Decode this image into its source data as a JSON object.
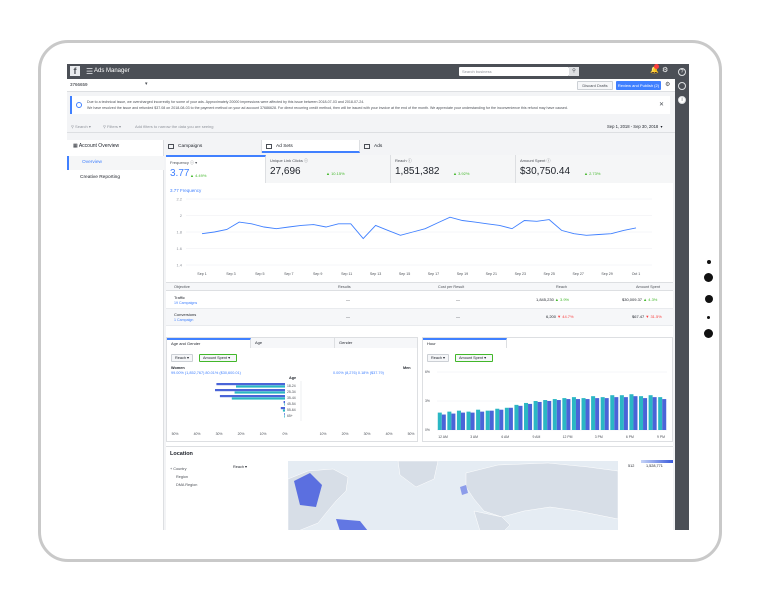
{
  "topbar": {
    "logo": "f",
    "menu_icon": "hamburger-icon",
    "title": "Ads Manager",
    "search_placeholder": "Search business"
  },
  "account_bar": {
    "account": "3766659",
    "discard": "Discard Drafts",
    "review": "Review and Publish (2)"
  },
  "notice": {
    "line1": "Due to a technical issue, we overcharged incorrectly for some of your ads. Approximately 20000 impressions were affected by this issue between 2018-07-03 and 2018-07-24.",
    "line2": "We have resolved the issue and refunded $37.08 on 2018-08-03 to the payment method on your ad account 37686628. For direct recurring credit method, then will be issued with your invoice at the end of the month. We appreciate your understanding for the inconvenience this refund may have caused."
  },
  "filters": {
    "search": "Search",
    "filters": "Filters",
    "hint": "Add filters to narrow the data you are seeing",
    "date_range": "Sep 1, 2018 - Sep 30, 2018"
  },
  "leftnav": {
    "heading": "Account Overview",
    "items": [
      "Overview",
      "Creative Reporting"
    ]
  },
  "tabs": [
    "Campaigns",
    "Ad Sets",
    "Ads"
  ],
  "metrics": [
    {
      "label": "Frequency",
      "value": "3.77",
      "delta": "4.49%"
    },
    {
      "label": "Unique Link Clicks",
      "value": "27,696",
      "delta": "10.15%"
    },
    {
      "label": "Reach",
      "value": "1,851,382",
      "delta": "3.92%"
    },
    {
      "label": "Amount Spent",
      "value": "$30,750.44",
      "delta": "2.73%"
    }
  ],
  "chart_data": {
    "type": "line",
    "title": "3.77 Frequency",
    "categories": [
      "Sep 1",
      "Sep 3",
      "Sep 5",
      "Sep 7",
      "Sep 9",
      "Sep 11",
      "Sep 13",
      "Sep 15",
      "Sep 17",
      "Sep 19",
      "Sep 21",
      "Sep 23",
      "Sep 25",
      "Sep 27",
      "Sep 29",
      "Oct 1"
    ],
    "x_labels": [
      "Sep 1",
      "Sep 3",
      "Sep 5",
      "Sep 7",
      "Sep 9",
      "Sep 11",
      "Sep 13",
      "Sep 15",
      "Sep 17",
      "Sep 19",
      "Sep 21",
      "Sep 23",
      "Sep 25",
      "Sep 27",
      "Sep 29",
      "Oct 1"
    ],
    "y_ticks": [
      "2.2",
      "2",
      "1.8",
      "1.6",
      "1.4"
    ],
    "ylim": [
      1.4,
      2.2
    ],
    "values": [
      1.78,
      1.8,
      1.83,
      1.92,
      1.9,
      1.86,
      1.84,
      1.86,
      1.88,
      1.89,
      1.86,
      1.9,
      1.9,
      1.72,
      1.88,
      1.82,
      1.76,
      1.8,
      1.84,
      1.91,
      1.98,
      1.94,
      1.92,
      1.9,
      1.88,
      1.84,
      1.94,
      1.93,
      1.95,
      1.82,
      1.78,
      1.76,
      1.77,
      1.78,
      1.82,
      1.85
    ],
    "color": "#4080ff"
  },
  "table": {
    "headers": [
      "Objective",
      "Results",
      "Cost per Result",
      "Reach",
      "Amount Spent"
    ],
    "rows": [
      {
        "name": "Traffic",
        "sub": "19 Campaigns",
        "results": "—",
        "cost": "—",
        "reach": "1,845,230",
        "reach_delta": "3.9%",
        "spent": "$30,009.37",
        "spent_delta": "4.3%"
      },
      {
        "name": "Conversions",
        "sub": "1 Campaign",
        "results": "—",
        "cost": "—",
        "reach": "6,200",
        "reach_delta": "44.7%",
        "spent": "$67.47",
        "spent_delta": "31.5%"
      }
    ]
  },
  "demographics": {
    "tabs": [
      "Age and Gender",
      "Age",
      "Gender"
    ],
    "dropdowns": [
      "Reach",
      "Amount Spent"
    ],
    "women_label": "Women",
    "men_label": "Men",
    "women_stats": "99.00% (1,852,767)   80.01% ($30,600.01)",
    "men_stats": "0.00% (8,276)   0.18% ($37.79)",
    "age_title": "Age",
    "age_groups": [
      "18-24",
      "25-34",
      "35-44",
      "45-54",
      "55-64",
      "65+"
    ],
    "women_reach": [
      0.98,
      1.0,
      0.93,
      0.02,
      0.06,
      0.01
    ],
    "women_spend": [
      0.7,
      0.72,
      0.76,
      0.01,
      0.03,
      0.01
    ],
    "axis_left": [
      "50%",
      "40%",
      "30%",
      "20%",
      "10%",
      "0%"
    ],
    "axis_right": [
      "10%",
      "20%",
      "30%",
      "40%",
      "50%"
    ]
  },
  "hourly": {
    "tab": "Hour",
    "dropdowns": [
      "Reach",
      "Amount Spent"
    ],
    "y_ticks": [
      "6%",
      "3%",
      "0%"
    ],
    "x_labels": [
      "12 AM",
      "3 AM",
      "6 AM",
      "9 AM",
      "12 PM",
      "3 PM",
      "6 PM",
      "9 PM"
    ],
    "reach": [
      1.8,
      1.9,
      2.0,
      1.9,
      2.1,
      2.0,
      2.2,
      2.3,
      2.6,
      2.8,
      3.0,
      3.1,
      3.2,
      3.3,
      3.4,
      3.3,
      3.5,
      3.4,
      3.6,
      3.6,
      3.7,
      3.5,
      3.6,
      3.4
    ],
    "spend": [
      1.6,
      1.7,
      1.8,
      1.8,
      1.9,
      2.0,
      2.1,
      2.3,
      2.5,
      2.7,
      2.9,
      3.0,
      3.1,
      3.2,
      3.2,
      3.2,
      3.3,
      3.3,
      3.4,
      3.4,
      3.5,
      3.3,
      3.4,
      3.2
    ],
    "colors": {
      "reach": "#2bb7c4",
      "spend": "#4a64d8"
    }
  },
  "location": {
    "title": "Location",
    "options": [
      "Country",
      "Region",
      "DMA Region"
    ],
    "dropdown": "Reach",
    "legend_min": "512",
    "legend_max": "1,528,771"
  }
}
